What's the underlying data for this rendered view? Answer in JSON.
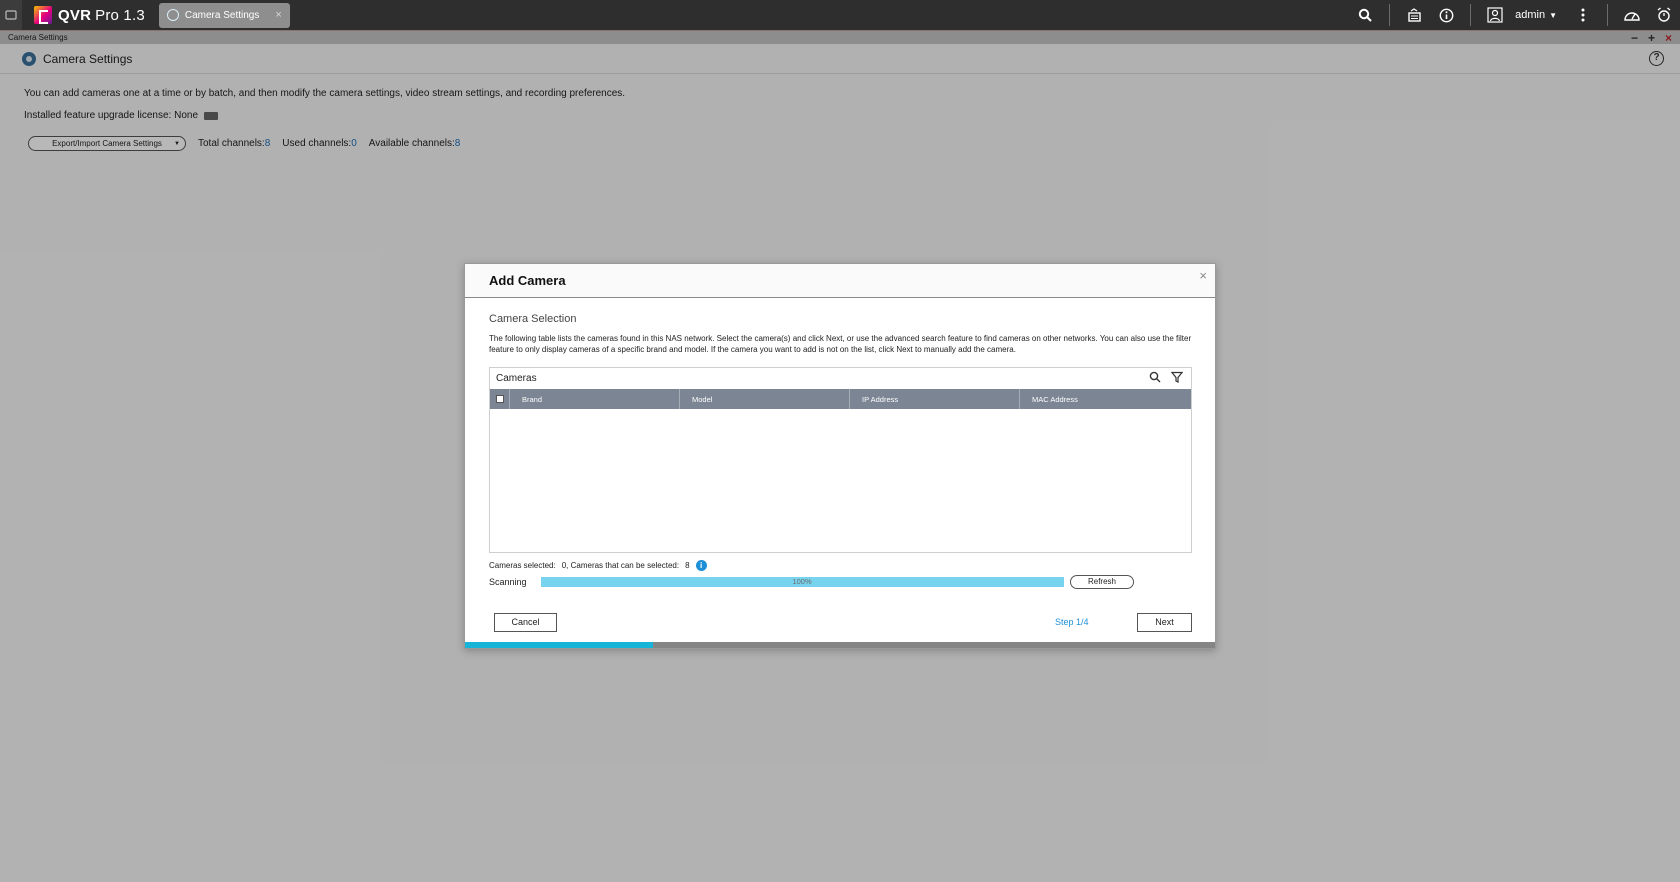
{
  "topbar": {
    "app_name": "QVR",
    "app_version": "Pro 1.3",
    "tab_label": "Camera Settings",
    "tab_close": "×",
    "user": "admin"
  },
  "window": {
    "title": "Camera Settings",
    "min": "−",
    "max": "+",
    "close": "×"
  },
  "page": {
    "header": "Camera Settings",
    "help": "?",
    "description": "You can add cameras one at a time or by batch, and then modify the camera settings, video stream settings, and recording preferences.",
    "license_label": "Installed feature upgrade license: None",
    "export_button": "Export/Import Camera Settings",
    "total_channels_label": "Total channels:",
    "total_channels": "8",
    "used_channels_label": "Used channels:",
    "used_channels": "0",
    "available_channels_label": "Available channels:",
    "available_channels": "8"
  },
  "modal": {
    "title": "Add Camera",
    "close": "×",
    "section_title": "Camera Selection",
    "description": "The following table lists the cameras found in this NAS network. Select the camera(s) and click Next, or use the advanced search feature to find cameras on other networks. You can also use the filter feature to only display cameras of a specific brand and model. If the camera you want to add is not on the list, click Next to manually add the camera.",
    "table_title": "Cameras",
    "columns": [
      "Brand",
      "Model",
      "IP Address",
      "MAC Address"
    ],
    "selected_label": "Cameras selected:",
    "selected_text": "0, Cameras that can be selected:",
    "selectable_count": "8",
    "scanning_label": "Scanning",
    "progress_percent": 100,
    "progress_text": "100%",
    "refresh_button": "Refresh",
    "cancel_button": "Cancel",
    "step_text": "Step 1/4",
    "next_button": "Next",
    "wizard_progress": 0.25
  },
  "colors": {
    "accent": "#17b4d8",
    "progress": "#78d3ee",
    "link": "#1d8fd6",
    "table_header": "#7c8593"
  }
}
